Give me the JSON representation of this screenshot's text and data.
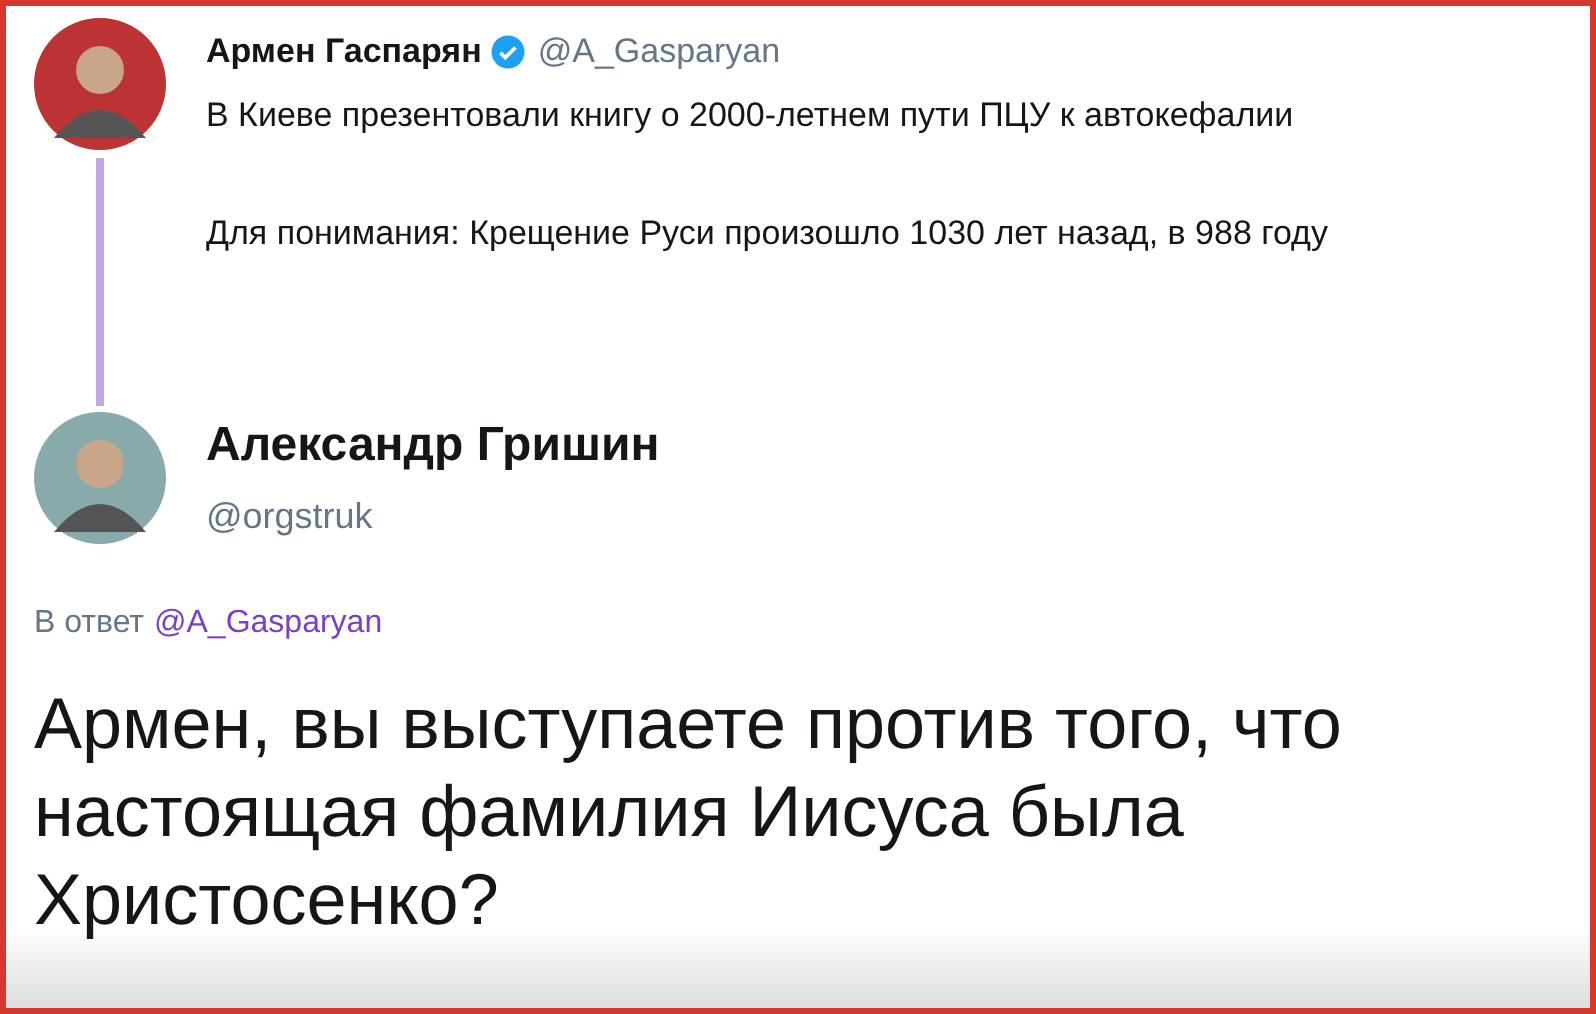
{
  "parent_tweet": {
    "name": "Армен Гаспарян",
    "verified": true,
    "handle": "@A_Gasparyan",
    "paragraphs": [
      "В Киеве презентовали книгу о 2000-летнем пути ПЦУ к автокефалии",
      "Для понимания: Крещение Руси произошло 1030 лет назад, в 988 году"
    ]
  },
  "reply_tweet": {
    "name": "Александр Гришин",
    "handle": "@orgstruk",
    "reply_prefix": "В ответ",
    "reply_to": "@A_Gasparyan",
    "text": "Армен, вы выступаете против того, что настоящая фамилия Иисуса была Христосенко?"
  }
}
